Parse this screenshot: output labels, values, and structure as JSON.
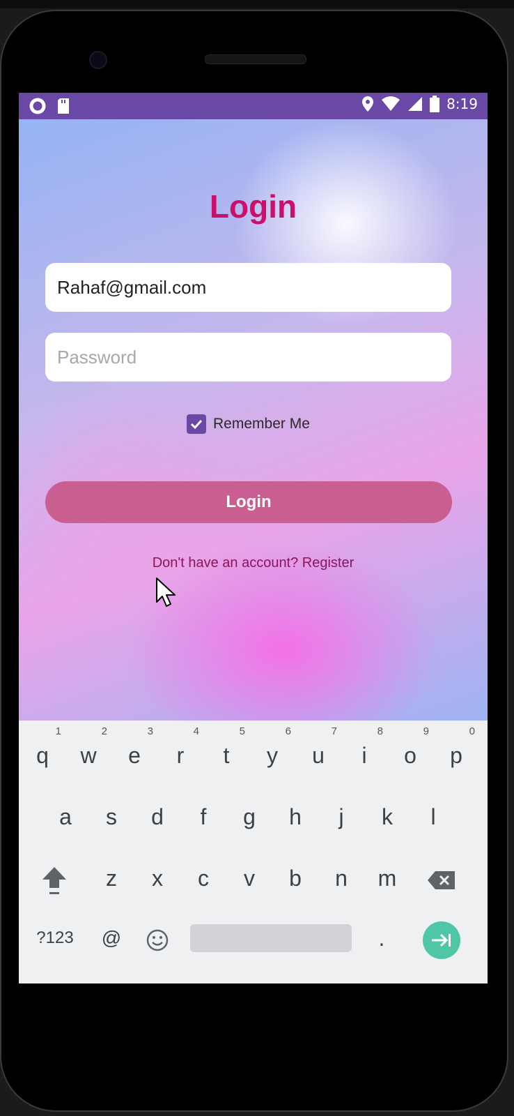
{
  "status_bar": {
    "time": "8:19",
    "icons": [
      "circle-icon",
      "sd-card-icon",
      "location-icon",
      "wifi-icon",
      "signal-icon",
      "battery-icon"
    ]
  },
  "login": {
    "title": "Login",
    "email_value": "Rahaf@gmail.com",
    "password_placeholder": "Password",
    "remember_label": "Remember Me",
    "remember_checked": true,
    "button_label": "Login",
    "register_text": "Don't have an account? Register"
  },
  "colors": {
    "accent": "#6a48a6",
    "title": "#cc0f6a",
    "button": "#c95e90",
    "enter_key": "#4fc7a7"
  },
  "keyboard": {
    "row1": [
      {
        "k": "q",
        "h": "1"
      },
      {
        "k": "w",
        "h": "2"
      },
      {
        "k": "e",
        "h": "3"
      },
      {
        "k": "r",
        "h": "4"
      },
      {
        "k": "t",
        "h": "5"
      },
      {
        "k": "y",
        "h": "6"
      },
      {
        "k": "u",
        "h": "7"
      },
      {
        "k": "i",
        "h": "8"
      },
      {
        "k": "o",
        "h": "9"
      },
      {
        "k": "p",
        "h": "0"
      }
    ],
    "row2": [
      "a",
      "s",
      "d",
      "f",
      "g",
      "h",
      "j",
      "k",
      "l"
    ],
    "row3": [
      "z",
      "x",
      "c",
      "v",
      "b",
      "n",
      "m"
    ],
    "symbols_label": "?123",
    "at_label": "@",
    "period_label": "."
  }
}
